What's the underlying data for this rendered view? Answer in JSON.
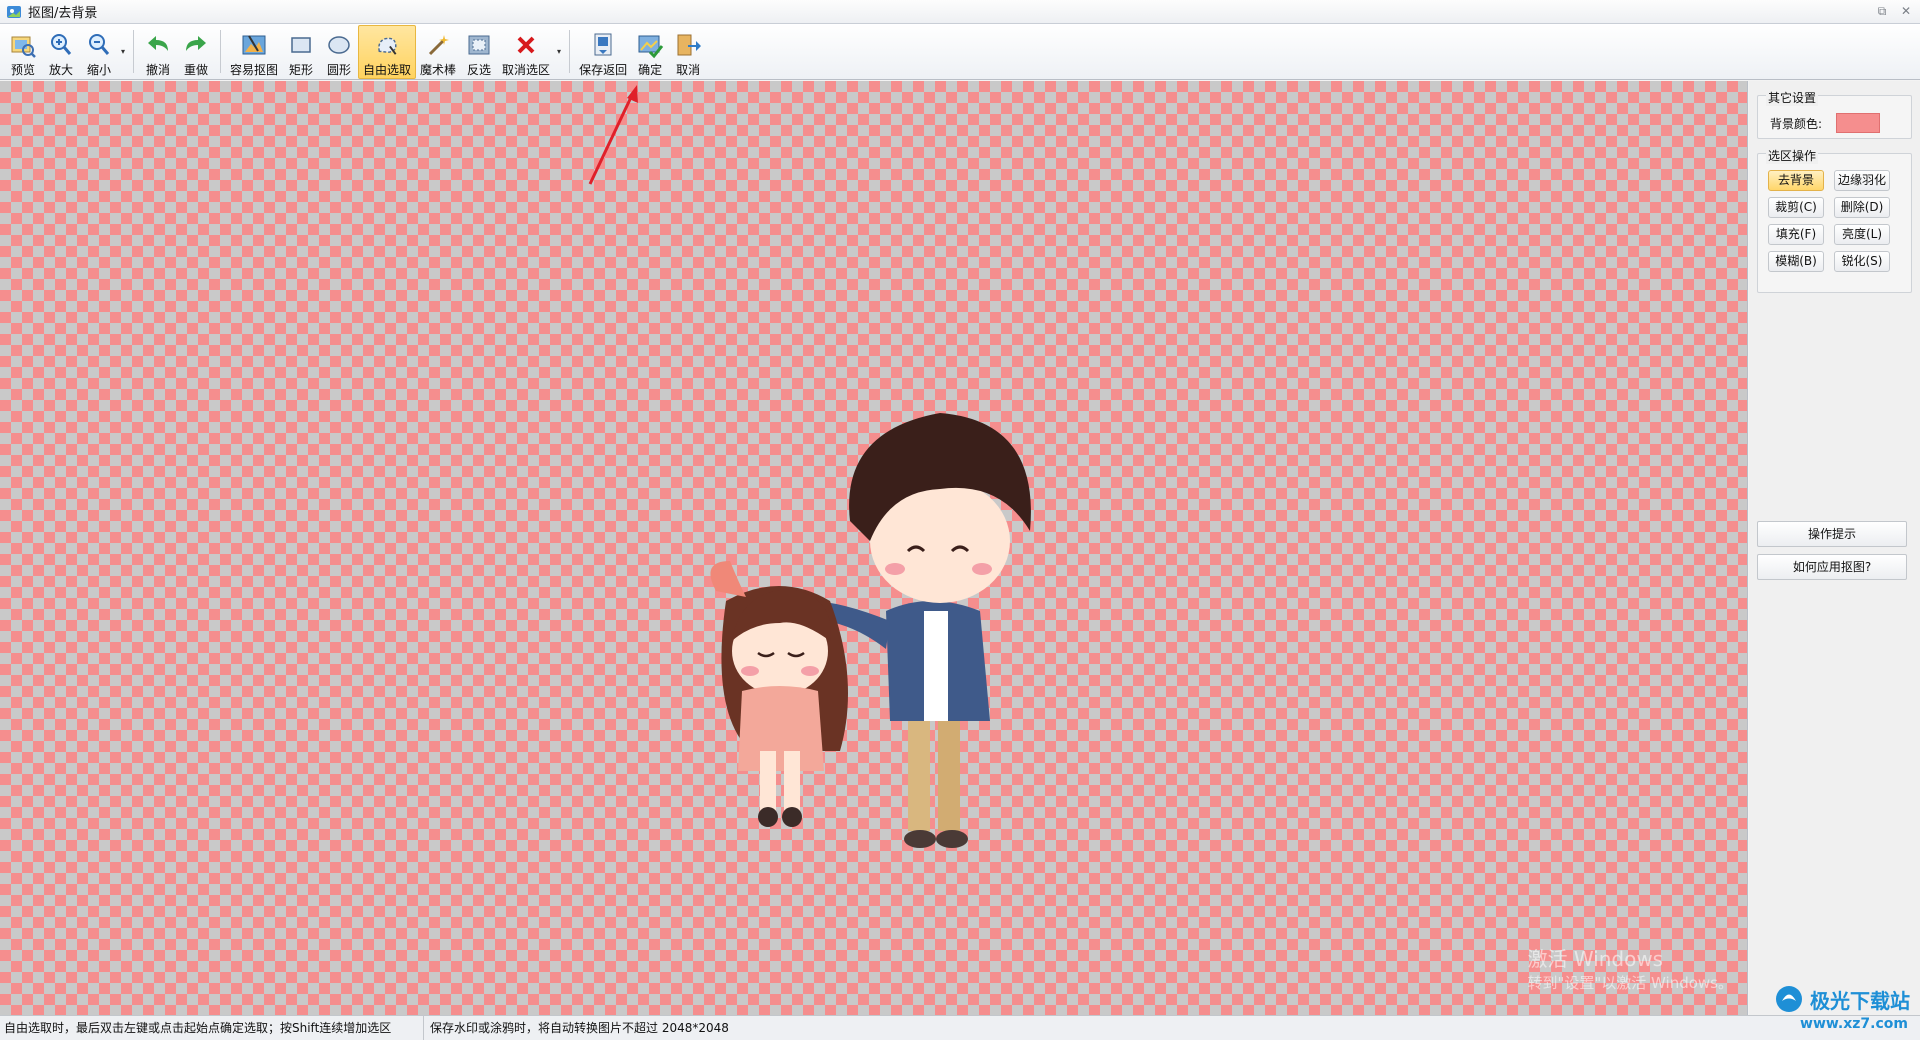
{
  "window": {
    "title": "抠图/去背景"
  },
  "toolbar": {
    "buttons": [
      {
        "label": "预览",
        "icon": "preview-icon"
      },
      {
        "label": "放大",
        "icon": "zoom-in-icon"
      },
      {
        "label": "缩小",
        "icon": "zoom-out-icon"
      },
      {
        "label": "撤消",
        "icon": "undo-icon"
      },
      {
        "label": "重做",
        "icon": "redo-icon"
      },
      {
        "label": "容易抠图",
        "icon": "easy-cutout-icon"
      },
      {
        "label": "矩形",
        "icon": "rectangle-select-icon"
      },
      {
        "label": "圆形",
        "icon": "ellipse-select-icon"
      },
      {
        "label": "自由选取",
        "icon": "free-select-icon"
      },
      {
        "label": "魔术棒",
        "icon": "magic-wand-icon"
      },
      {
        "label": "反选",
        "icon": "invert-selection-icon"
      },
      {
        "label": "取消选区",
        "icon": "cancel-selection-icon"
      },
      {
        "label": "保存返回",
        "icon": "save-return-icon"
      },
      {
        "label": "确定",
        "icon": "confirm-icon"
      },
      {
        "label": "取消",
        "icon": "cancel-icon"
      }
    ],
    "active": "自由选取"
  },
  "side_panel": {
    "other_settings": {
      "title": "其它设置",
      "bg_color_label": "背景颜色:",
      "bg_color": "#f58e8e"
    },
    "selection_ops": {
      "title": "选区操作",
      "buttons": [
        "去背景",
        "边缘羽化",
        "裁剪(C)",
        "删除(D)",
        "填充(F)",
        "亮度(L)",
        "模糊(B)",
        "锐化(S)"
      ]
    },
    "hint_button": "操作提示",
    "how_button": "如何应用抠图?"
  },
  "statusbar": {
    "left": "自由选取时，最后双击左键或点击起始点确定选取；按Shift连续增加选区",
    "right": "保存水印或涂鸦时，将自动转换图片不超过 2048*2048"
  },
  "watermark": {
    "line1": "激活 Windows",
    "line2": "转到\"设置\"以激活 Windows。"
  },
  "brand": {
    "name": "极光下载站",
    "url": "www.xz7.com"
  },
  "colors": {
    "checker_pink": "#f58e8e",
    "checker_gray": "#c9c9c9",
    "active_tool": "#ffd35f",
    "arrow": "#e0202a"
  }
}
